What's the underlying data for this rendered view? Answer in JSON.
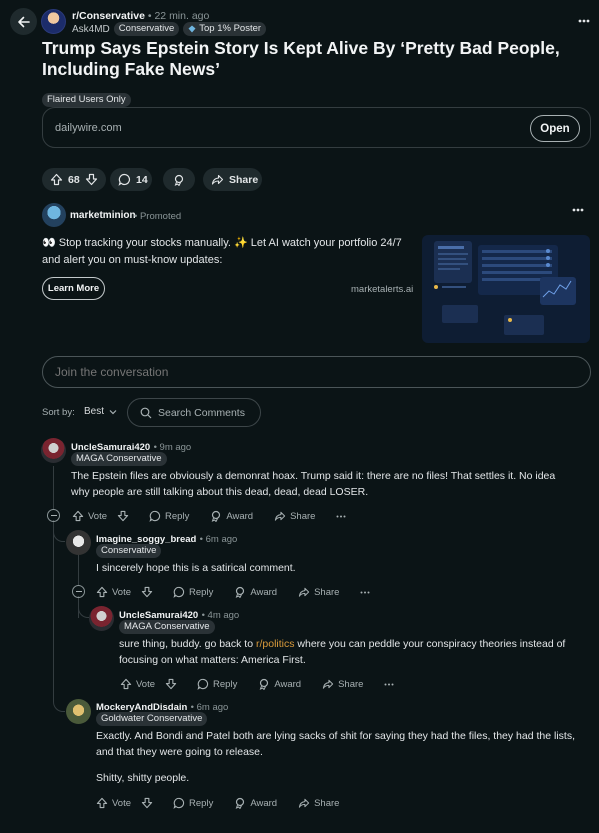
{
  "header": {
    "subreddit": "r/Conservative",
    "post_time": "22 min. ago",
    "author": "Ask4MD",
    "author_flair": "Conservative",
    "author_badge": "Top 1% Poster",
    "title": "Trump Says Epstein Story Is Kept Alive By ‘Pretty Bad People, Including Fake News’",
    "post_flair": "Flaired Users Only"
  },
  "link_card": {
    "domain": "dailywire.com",
    "open_label": "Open"
  },
  "actions": {
    "score": "68",
    "comments": "14",
    "share_label": "Share"
  },
  "promoted": {
    "advertiser": "marketminion",
    "promoted_label": "Promoted",
    "text": "👀 Stop tracking your stocks manually. ✨ Let AI watch your portfolio 24/7 and alert you on must-know updates:",
    "cta": "Learn More",
    "domain": "marketalerts.ai"
  },
  "conversation": {
    "placeholder": "Join the conversation",
    "sort_label": "Sort by:",
    "sort_value": "Best",
    "search_placeholder": "Search Comments"
  },
  "labels": {
    "vote": "Vote",
    "reply": "Reply",
    "award": "Award",
    "share": "Share"
  },
  "comments": [
    {
      "user": "UncleSamurai420",
      "time": "9m ago",
      "flair": "MAGA Conservative",
      "body": "The Epstein files are obviously a demonrat hoax. Trump said it: there are no files! That settles it. No idea why people are still talking about this dead, dead, dead LOSER."
    },
    {
      "user": "Imagine_soggy_bread",
      "time": "6m ago",
      "flair": "Conservative",
      "body": "I sincerely hope this is a satirical comment."
    },
    {
      "user": "UncleSamurai420",
      "time": "4m ago",
      "flair": "MAGA Conservative",
      "body_pre": "sure thing, buddy. go back to ",
      "body_link": "r/politics",
      "body_post": " where you can peddle your conspiracy theories instead of focusing on what matters: America First."
    },
    {
      "user": "MockeryAndDisdain",
      "time": "6m ago",
      "flair": "Goldwater Conservative",
      "body": "Exactly. And Bondi and Patel both are lying sacks of shit for saying they had the files, they had the lists, and that they were going to release.",
      "body2": "Shitty, shitty people."
    }
  ],
  "colors": {
    "background": "#0b1416",
    "link": "#d99a3b",
    "pill": "#2a3236"
  }
}
